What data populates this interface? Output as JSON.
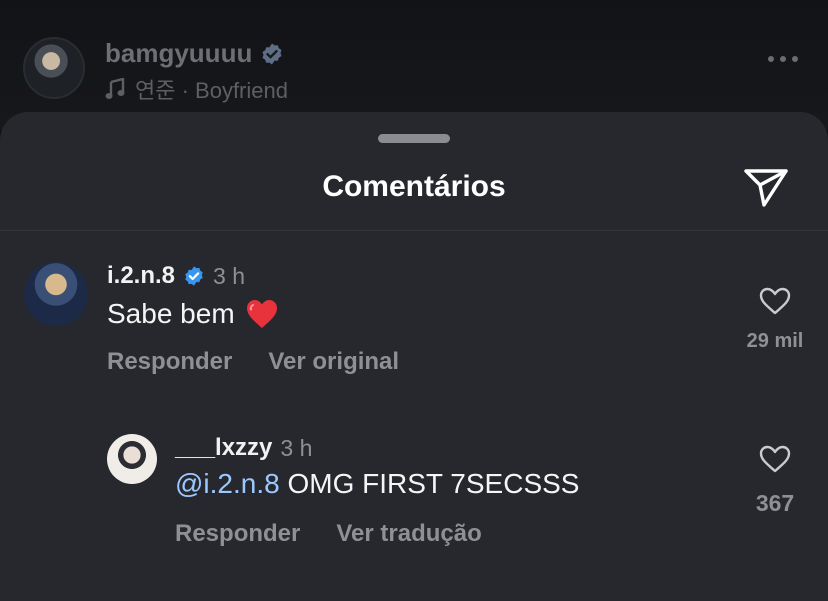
{
  "post": {
    "username": "bamgyuuuu",
    "music": "연준 · Boyfriend"
  },
  "sheet": {
    "title": "Comentários"
  },
  "comments": [
    {
      "username": "i.2.n.8",
      "time": "3 h",
      "text": "Sabe bem",
      "reply_label": "Responder",
      "translate_label": "Ver original",
      "likes": "29 mil"
    },
    {
      "username": "___lxzzy",
      "time": "3 h",
      "mention": "@i.2.n.8",
      "text": "OMG FIRST 7SECSSS",
      "reply_label": "Responder",
      "translate_label": "Ver tradução",
      "likes": "367"
    }
  ],
  "colors": {
    "sheet_bg": "#26282d",
    "verified": "#3797f0",
    "mention": "#9bc8ff",
    "heart_emoji": "#e8323c"
  },
  "icons": [
    "verified-badge-icon",
    "music-note-icon",
    "more-icon",
    "send-icon",
    "heart-emoji-icon",
    "heart-outline-icon"
  ]
}
